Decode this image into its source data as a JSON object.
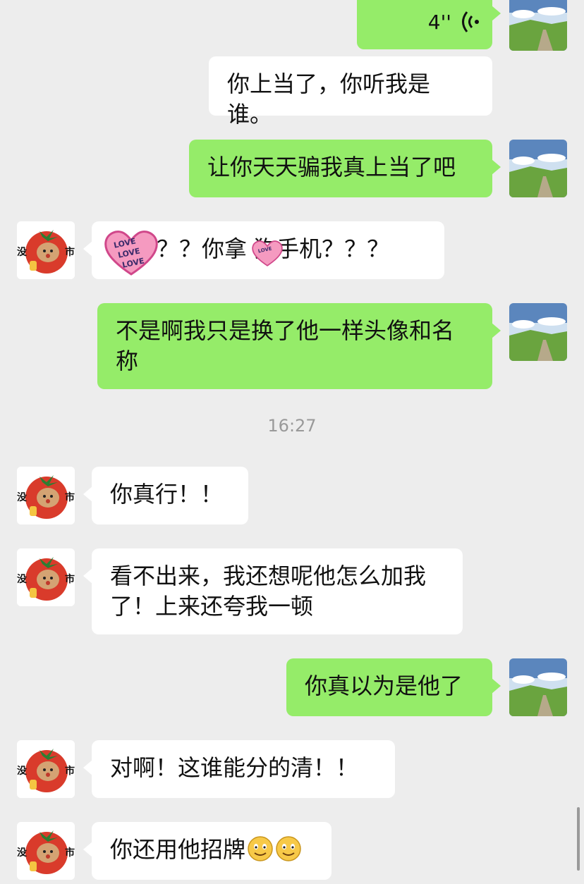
{
  "messages": [
    {
      "side": "out",
      "type": "voice",
      "duration": "4''"
    },
    {
      "side": "out",
      "text": "你上当了，你听我是谁。"
    },
    {
      "side": "out",
      "text": "让你天天骗我真上当了吧"
    },
    {
      "side": "in",
      "text": "？？你拿 狗手机？？？",
      "sticker_text": "LOVE"
    },
    {
      "side": "out",
      "text": "不是啊我只是换了他一样头像和名称"
    },
    {
      "side": "in",
      "text": "你真行！！"
    },
    {
      "side": "in",
      "text": "看不出来，我还想呢他怎么加我了！上来还夸我一顿"
    },
    {
      "side": "out",
      "text": "你真以为是他了"
    },
    {
      "side": "in",
      "text": "对啊！这谁能分的清！！"
    },
    {
      "side": "in",
      "text": "你还用他招牌",
      "emoji": "smile-emoji"
    }
  ],
  "timestamp": "16:27",
  "contact_avatar": {
    "icon": "tomato-avatar-icon",
    "text_left": "没",
    "text_right": "市"
  },
  "self_avatar": {
    "icon": "landscape-avatar-icon"
  },
  "colors": {
    "background": "#ededed",
    "out_bubble": "#95ec69",
    "in_bubble": "#ffffff",
    "timestamp": "#999999"
  }
}
